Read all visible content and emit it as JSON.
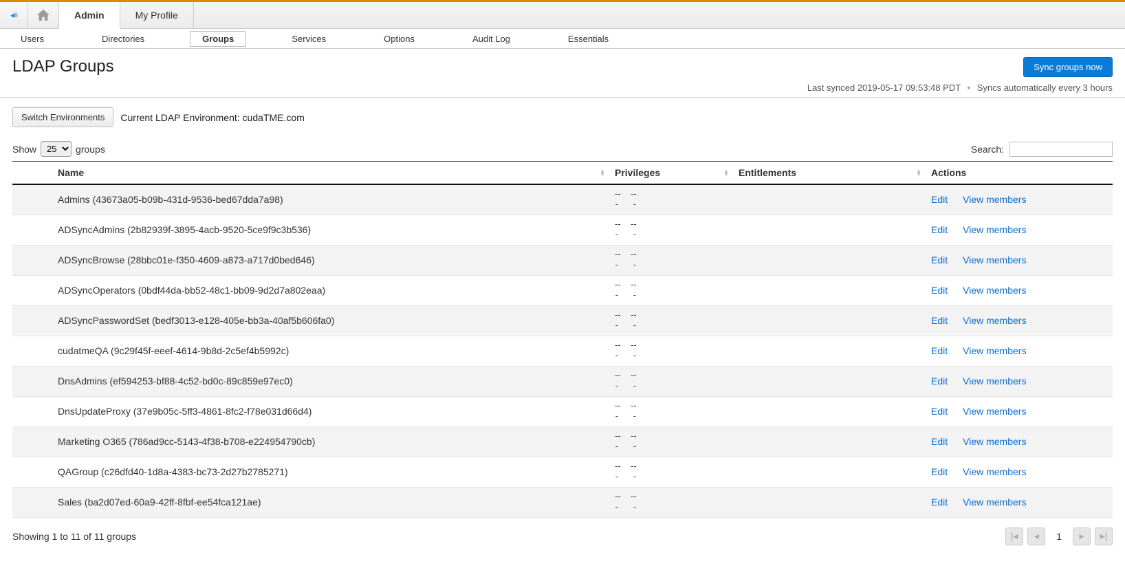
{
  "top": {
    "admin": "Admin",
    "profile": "My Profile"
  },
  "subnav": {
    "users": "Users",
    "directories": "Directories",
    "groups": "Groups",
    "services": "Services",
    "options": "Options",
    "audit": "Audit Log",
    "essentials": "Essentials"
  },
  "page": {
    "title": "LDAP Groups",
    "sync_button": "Sync groups now",
    "last_synced": "Last synced 2019-05-17 09:53:48 PDT",
    "auto_sync": "Syncs automatically every 3 hours"
  },
  "env": {
    "switch_btn": "Switch Environments",
    "label": "Current LDAP Environment: cudaTME.com"
  },
  "controls": {
    "show_pre": "Show",
    "show_post": "groups",
    "show_value": "25",
    "search_label": "Search:"
  },
  "columns": {
    "name": "Name",
    "privileges": "Privileges",
    "entitlements": "Entitlements",
    "actions": "Actions"
  },
  "actions": {
    "edit": "Edit",
    "view": "View members"
  },
  "priv": {
    "dashes_top": "--",
    "dashes_bot": "-"
  },
  "rows": [
    {
      "name": "Admins (43673a05-b09b-431d-9536-bed67dda7a98)"
    },
    {
      "name": "ADSyncAdmins (2b82939f-3895-4acb-9520-5ce9f9c3b536)"
    },
    {
      "name": "ADSyncBrowse (28bbc01e-f350-4609-a873-a717d0bed646)"
    },
    {
      "name": "ADSyncOperators (0bdf44da-bb52-48c1-bb09-9d2d7a802eaa)"
    },
    {
      "name": "ADSyncPasswordSet (bedf3013-e128-405e-bb3a-40af5b606fa0)"
    },
    {
      "name": "cudatmeQA (9c29f45f-eeef-4614-9b8d-2c5ef4b5992c)"
    },
    {
      "name": "DnsAdmins (ef594253-bf88-4c52-bd0c-89c859e97ec0)"
    },
    {
      "name": "DnsUpdateProxy (37e9b05c-5ff3-4861-8fc2-f78e031d66d4)"
    },
    {
      "name": "Marketing O365 (786ad9cc-5143-4f38-b708-e224954790cb)"
    },
    {
      "name": "QAGroup (c26dfd40-1d8a-4383-bc73-2d27b2785271)"
    },
    {
      "name": "Sales (ba2d07ed-60a9-42ff-8fbf-ee54fca121ae)"
    }
  ],
  "footer": {
    "showing": "Showing 1 to 11 of 11 groups",
    "page": "1"
  }
}
